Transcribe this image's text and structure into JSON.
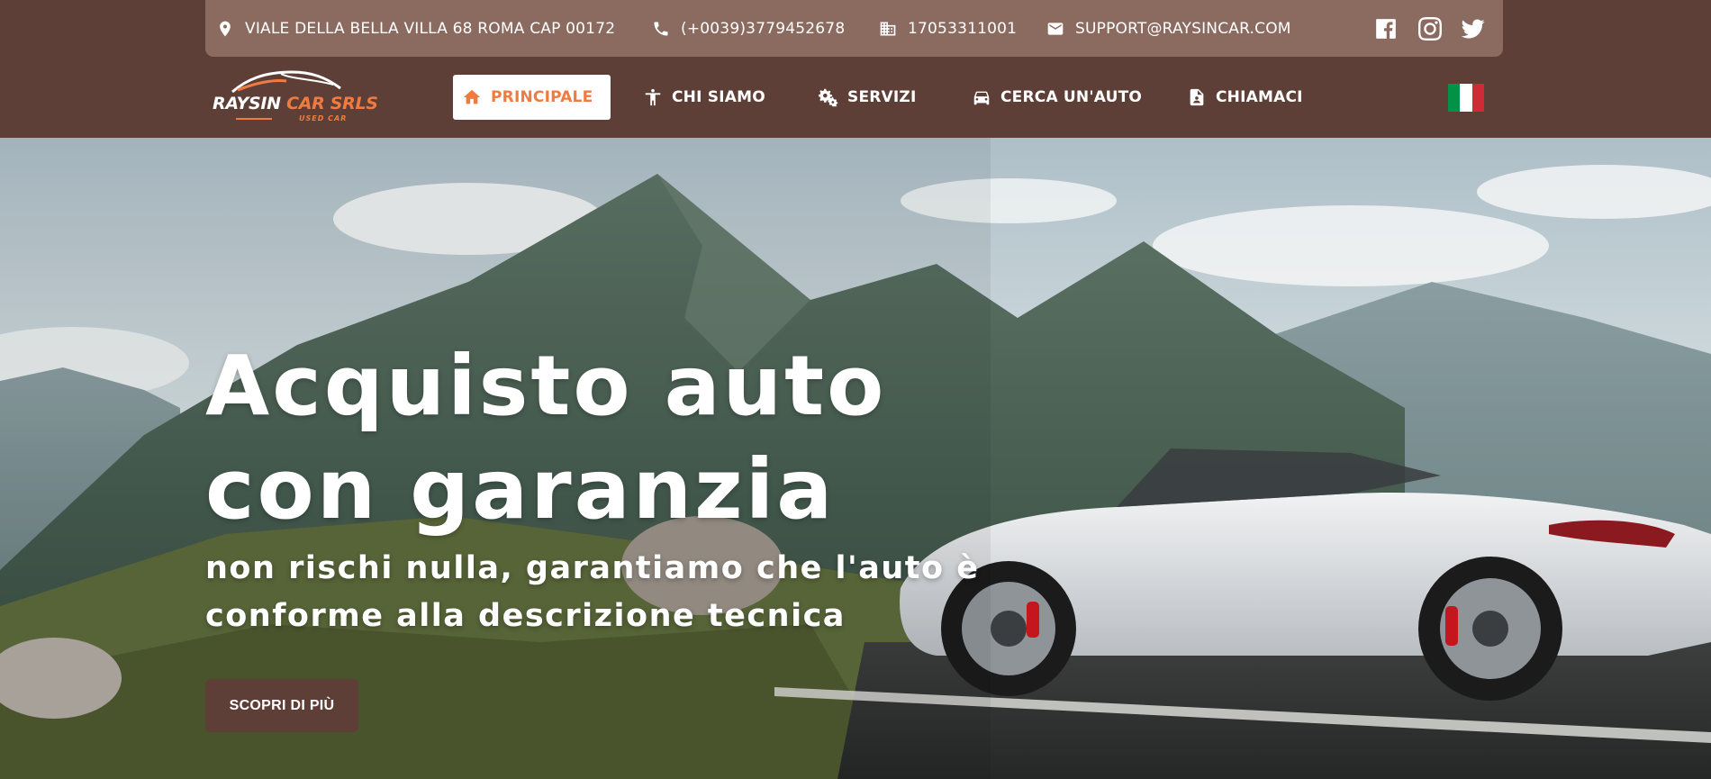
{
  "contact": {
    "address": "VIALE DELLA BELLA VILLA 68 ROMA CAP 00172",
    "phone": "(+0039)3779452678",
    "vat": "17053311001",
    "email": "SUPPORT@RAYSINCAR.COM"
  },
  "social": [
    "facebook-icon",
    "instagram-icon",
    "twitter-icon"
  ],
  "brand": {
    "name_white": "RAYSIN ",
    "name_orange": "CAR SRLS",
    "tagline": "USED CAR"
  },
  "nav": {
    "items": [
      {
        "label": "PRINCIPALE",
        "icon": "home-icon",
        "active": true
      },
      {
        "label": "CHI SIAMO",
        "icon": "person-icon",
        "active": false
      },
      {
        "label": "SERVIZI",
        "icon": "gears-icon",
        "active": false
      },
      {
        "label": "CERCA UN'AUTO",
        "icon": "car-icon",
        "active": false
      },
      {
        "label": "CHIAMACI",
        "icon": "contact-file-icon",
        "active": false
      }
    ]
  },
  "language": {
    "flag": "italy-flag-icon",
    "colors": [
      "#009246",
      "#ffffff",
      "#ce2b37"
    ]
  },
  "hero": {
    "title_line1": "Acquisto auto",
    "title_line2": "con garanzia",
    "subtitle_line1": "non rischi nulla, garantiamo che l'auto è",
    "subtitle_line2": "conforme alla descrizione tecnica",
    "button": "SCOPRI DI PIÙ"
  },
  "colors": {
    "brown": "#5e3f37",
    "brown_light": "#8b6a60",
    "orange": "#f07b41"
  }
}
